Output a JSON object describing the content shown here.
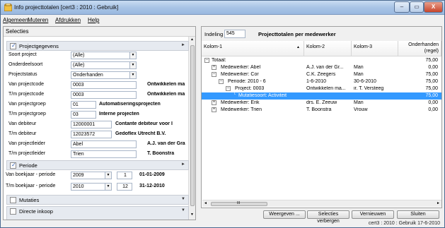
{
  "window": {
    "title": "Info projecttotalen",
    "context": "[cert3 : 2010 : Gebruik]",
    "min_label": "–",
    "max_label": "▭",
    "close_label": "X"
  },
  "menu": [
    "Algemeen",
    "Muteren",
    "Afdrukken",
    "Help"
  ],
  "left": {
    "section_title": "Selecties",
    "groups": [
      {
        "label": "Projectgegevens",
        "checked": true,
        "arrow": "►"
      },
      {
        "label": "Periode",
        "checked": true,
        "arrow": "►"
      },
      {
        "label": "Mutaties",
        "checked": false,
        "arrow": "▼"
      },
      {
        "label": "Directe inkoop",
        "checked": false,
        "arrow": "▼"
      }
    ],
    "fields": [
      {
        "label": "Soort project",
        "value": "(Alle)",
        "desc": ""
      },
      {
        "label": "Onderdeelsoort",
        "value": "(Alle)",
        "desc": ""
      },
      {
        "label": "Projectstatus",
        "value": "Onderhanden",
        "desc": ""
      },
      {
        "label": "Van projectcode",
        "value": "0003",
        "desc": "Ontwikkelen ma"
      },
      {
        "label": "T/m projectcode",
        "value": "0003",
        "desc": "Ontwikkelen ma"
      },
      {
        "label": "Van projectgroep",
        "value": "01",
        "desc": "Automatiseringsprojecten"
      },
      {
        "label": "T/m projectgroep",
        "value": "03",
        "desc": "Interne projecten"
      },
      {
        "label": "Van debiteur",
        "value": "12000001",
        "desc": "Contante debiteur voor I"
      },
      {
        "label": "T/m debiteur",
        "value": "12023572",
        "desc": "Gedoflex Utrecht B.V."
      },
      {
        "label": "Van projectleider",
        "value": "Abel",
        "desc": "A.J. van der Gra"
      },
      {
        "label": "T/m projectleider",
        "value": "Trien",
        "desc": "T. Boonstra"
      }
    ],
    "periods": [
      {
        "label": "Van boekjaar - periode",
        "year": "2009",
        "period": "1",
        "date": "01-01-2009"
      },
      {
        "label": "T/m boekjaar - periode",
        "year": "2010",
        "period": "12",
        "date": "31-12-2010"
      }
    ]
  },
  "right": {
    "indeling_label": "Indeling",
    "indeling_value": "545",
    "heading": "Projecttotalen per medewerker",
    "columns": [
      "Kolom-1",
      "Kolom-2",
      "Kolom-3",
      "Onderhanden (regel)"
    ],
    "rows": [
      {
        "expander": "–",
        "c1": "Totaal:",
        "c2": "",
        "c3": "",
        "c4": "75,00"
      },
      {
        "expander": "+",
        "c1": "Medewerker: Abel",
        "c2": "A.J. van der Gr...",
        "c3": "Man",
        "c4": "0,00"
      },
      {
        "expander": "–",
        "c1": "Medewerker: Cor",
        "c2": "C.K. Zeegers",
        "c3": "Man",
        "c4": "75,00"
      },
      {
        "expander": "–",
        "c1": "Periode: 2010 - 6",
        "c2": "1-6-2010",
        "c3": "30-6-2010",
        "c4": "75,00"
      },
      {
        "expander": "–",
        "c1": "Project: 0003",
        "c2": "Ontwikkelen ma...",
        "c3": "ir. T. Versteeg",
        "c4": "75,00"
      },
      {
        "expander": "",
        "c1": "Mutatiesoort: Activiteit",
        "c2": "",
        "c3": "",
        "c4": "75,00"
      },
      {
        "expander": "+",
        "c1": "Medewerker: Erik",
        "c2": "drs. E. Zeeuw",
        "c3": "Man",
        "c4": "0,00"
      },
      {
        "expander": "+",
        "c1": "Medewerker: Trien",
        "c2": "T. Boonstra",
        "c3": "Vrouw",
        "c4": "0,00"
      }
    ],
    "scroll_grip": "III"
  },
  "buttons": [
    "Weergeven ...",
    "Selecties verbergen",
    "Vernieuwen",
    "Sluiten"
  ],
  "status": "cert3 : 2010 : Gebruik   17-6-2010",
  "colors": {
    "selection": "#3399ff",
    "title_bar": "#a9c4e6"
  }
}
